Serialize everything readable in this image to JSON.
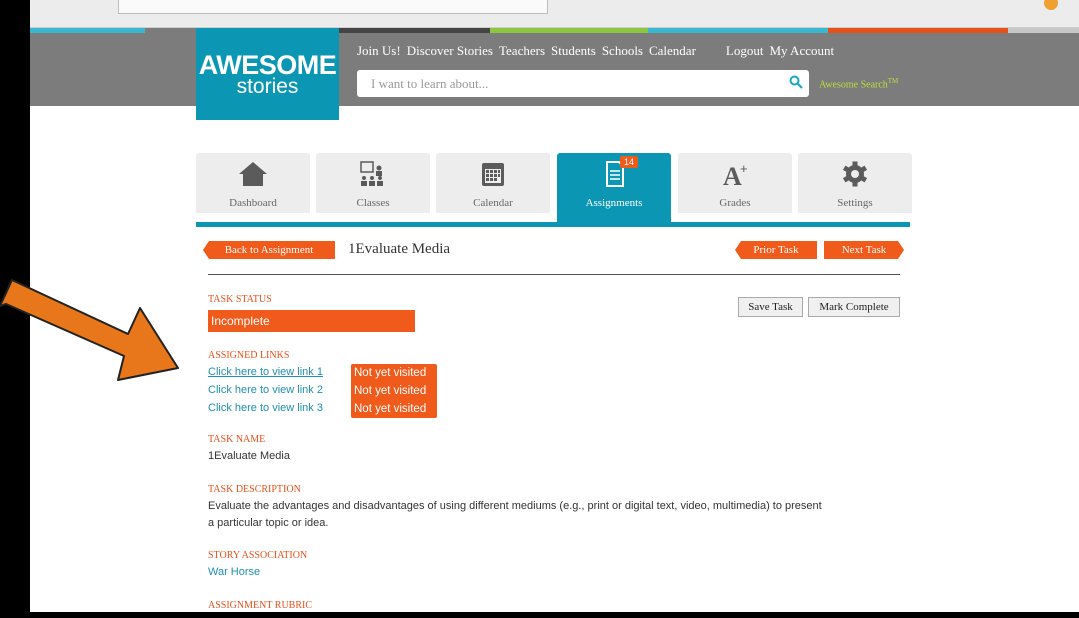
{
  "colors": {
    "brand_teal": "#0b97b4",
    "accent_orange": "#f05a1a",
    "header_gray": "#7c7c7c",
    "stripe": [
      "#3ab7d1",
      "#7c7c7c",
      "#444444",
      "#8dc63f",
      "#3ab7d1",
      "#e8501a",
      "#c8c8c8"
    ]
  },
  "logo": {
    "line1": "AWESOME",
    "line2": "stories"
  },
  "topnav": {
    "join": "Join Us!",
    "discover": "Discover Stories",
    "teachers": "Teachers",
    "students": "Students",
    "schools": "Schools",
    "calendar": "Calendar",
    "logout": "Logout",
    "account": "My Account"
  },
  "search": {
    "placeholder": "I want to learn about...",
    "awesome_search": "Awesome Search",
    "tm": "TM"
  },
  "tabs": [
    {
      "label": "Dashboard",
      "icon": "home-icon"
    },
    {
      "label": "Classes",
      "icon": "classroom-icon"
    },
    {
      "label": "Calendar",
      "icon": "calendar-icon"
    },
    {
      "label": "Assignments",
      "icon": "document-icon",
      "badge": "14"
    },
    {
      "label": "Grades",
      "icon": "grade-icon"
    },
    {
      "label": "Settings",
      "icon": "gear-icon"
    }
  ],
  "task": {
    "back": "Back to Assignment",
    "title": "1Evaluate Media",
    "prior": "Prior Task",
    "next": "Next Task",
    "save": "Save Task",
    "complete": "Mark Complete"
  },
  "sections": {
    "status_label": "TASK STATUS",
    "status_value": "Incomplete",
    "links_label": "ASSIGNED LINKS",
    "links": [
      {
        "text": "Click here to view link 1",
        "state": "Not yet visited"
      },
      {
        "text": "Click here to view link 2",
        "state": "Not yet visited"
      },
      {
        "text": "Click here to view link 3",
        "state": "Not yet visited"
      }
    ],
    "name_label": "TASK NAME",
    "name_value": "1Evaluate Media",
    "desc_label": "TASK DESCRIPTION",
    "desc_line1": "Evaluate the advantages and disadvantages of using different mediums (e.g., print or digital text, video, multimedia) to present",
    "desc_line2": "a particular topic or idea.",
    "story_label": "STORY ASSOCIATION",
    "story_value": "War Horse",
    "rubric_label": "ASSIGNMENT RUBRIC"
  }
}
